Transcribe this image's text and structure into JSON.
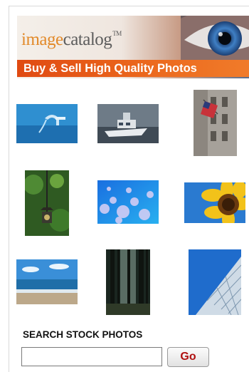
{
  "header": {
    "logo_part1": "image",
    "logo_part2": "catalog",
    "logo_tm": "TM",
    "tagline": "Buy & Sell High Quality Photos",
    "brand_orange": "#e2541a"
  },
  "gallery": {
    "items": [
      {
        "name": "photo-blue-faucet",
        "subject": "blue faucet"
      },
      {
        "name": "photo-boat",
        "subject": "boat"
      },
      {
        "name": "photo-building-flag",
        "subject": "building with flag"
      },
      {
        "name": "photo-garden-lantern",
        "subject": "garden lantern"
      },
      {
        "name": "photo-blue-bubbles",
        "subject": "blue bubbles"
      },
      {
        "name": "photo-sunflower",
        "subject": "sunflower"
      },
      {
        "name": "photo-beach-sea",
        "subject": "beach and sea"
      },
      {
        "name": "photo-forest",
        "subject": "forest"
      },
      {
        "name": "photo-skyscraper",
        "subject": "skyscraper"
      }
    ]
  },
  "search": {
    "title": "SEARCH STOCK PHOTOS",
    "value": "",
    "placeholder": "",
    "go_label": "Go",
    "go_color": "#b01010"
  }
}
